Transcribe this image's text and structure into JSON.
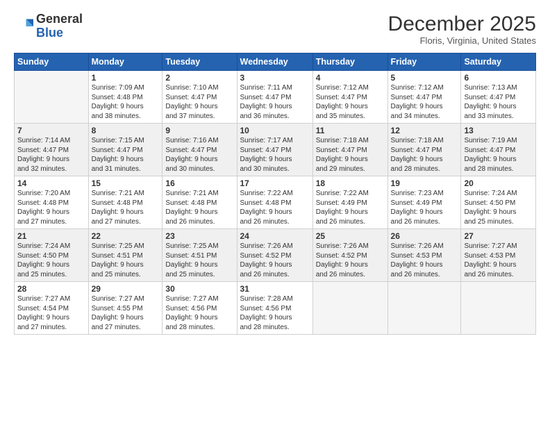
{
  "logo": {
    "general": "General",
    "blue": "Blue"
  },
  "header": {
    "month": "December 2025",
    "location": "Floris, Virginia, United States"
  },
  "weekdays": [
    "Sunday",
    "Monday",
    "Tuesday",
    "Wednesday",
    "Thursday",
    "Friday",
    "Saturday"
  ],
  "weeks": [
    [
      {
        "day": "",
        "info": ""
      },
      {
        "day": "1",
        "info": "Sunrise: 7:09 AM\nSunset: 4:48 PM\nDaylight: 9 hours\nand 38 minutes."
      },
      {
        "day": "2",
        "info": "Sunrise: 7:10 AM\nSunset: 4:47 PM\nDaylight: 9 hours\nand 37 minutes."
      },
      {
        "day": "3",
        "info": "Sunrise: 7:11 AM\nSunset: 4:47 PM\nDaylight: 9 hours\nand 36 minutes."
      },
      {
        "day": "4",
        "info": "Sunrise: 7:12 AM\nSunset: 4:47 PM\nDaylight: 9 hours\nand 35 minutes."
      },
      {
        "day": "5",
        "info": "Sunrise: 7:12 AM\nSunset: 4:47 PM\nDaylight: 9 hours\nand 34 minutes."
      },
      {
        "day": "6",
        "info": "Sunrise: 7:13 AM\nSunset: 4:47 PM\nDaylight: 9 hours\nand 33 minutes."
      }
    ],
    [
      {
        "day": "7",
        "info": "Sunrise: 7:14 AM\nSunset: 4:47 PM\nDaylight: 9 hours\nand 32 minutes."
      },
      {
        "day": "8",
        "info": "Sunrise: 7:15 AM\nSunset: 4:47 PM\nDaylight: 9 hours\nand 31 minutes."
      },
      {
        "day": "9",
        "info": "Sunrise: 7:16 AM\nSunset: 4:47 PM\nDaylight: 9 hours\nand 30 minutes."
      },
      {
        "day": "10",
        "info": "Sunrise: 7:17 AM\nSunset: 4:47 PM\nDaylight: 9 hours\nand 30 minutes."
      },
      {
        "day": "11",
        "info": "Sunrise: 7:18 AM\nSunset: 4:47 PM\nDaylight: 9 hours\nand 29 minutes."
      },
      {
        "day": "12",
        "info": "Sunrise: 7:18 AM\nSunset: 4:47 PM\nDaylight: 9 hours\nand 28 minutes."
      },
      {
        "day": "13",
        "info": "Sunrise: 7:19 AM\nSunset: 4:47 PM\nDaylight: 9 hours\nand 28 minutes."
      }
    ],
    [
      {
        "day": "14",
        "info": "Sunrise: 7:20 AM\nSunset: 4:48 PM\nDaylight: 9 hours\nand 27 minutes."
      },
      {
        "day": "15",
        "info": "Sunrise: 7:21 AM\nSunset: 4:48 PM\nDaylight: 9 hours\nand 27 minutes."
      },
      {
        "day": "16",
        "info": "Sunrise: 7:21 AM\nSunset: 4:48 PM\nDaylight: 9 hours\nand 26 minutes."
      },
      {
        "day": "17",
        "info": "Sunrise: 7:22 AM\nSunset: 4:48 PM\nDaylight: 9 hours\nand 26 minutes."
      },
      {
        "day": "18",
        "info": "Sunrise: 7:22 AM\nSunset: 4:49 PM\nDaylight: 9 hours\nand 26 minutes."
      },
      {
        "day": "19",
        "info": "Sunrise: 7:23 AM\nSunset: 4:49 PM\nDaylight: 9 hours\nand 26 minutes."
      },
      {
        "day": "20",
        "info": "Sunrise: 7:24 AM\nSunset: 4:50 PM\nDaylight: 9 hours\nand 25 minutes."
      }
    ],
    [
      {
        "day": "21",
        "info": "Sunrise: 7:24 AM\nSunset: 4:50 PM\nDaylight: 9 hours\nand 25 minutes."
      },
      {
        "day": "22",
        "info": "Sunrise: 7:25 AM\nSunset: 4:51 PM\nDaylight: 9 hours\nand 25 minutes."
      },
      {
        "day": "23",
        "info": "Sunrise: 7:25 AM\nSunset: 4:51 PM\nDaylight: 9 hours\nand 25 minutes."
      },
      {
        "day": "24",
        "info": "Sunrise: 7:26 AM\nSunset: 4:52 PM\nDaylight: 9 hours\nand 26 minutes."
      },
      {
        "day": "25",
        "info": "Sunrise: 7:26 AM\nSunset: 4:52 PM\nDaylight: 9 hours\nand 26 minutes."
      },
      {
        "day": "26",
        "info": "Sunrise: 7:26 AM\nSunset: 4:53 PM\nDaylight: 9 hours\nand 26 minutes."
      },
      {
        "day": "27",
        "info": "Sunrise: 7:27 AM\nSunset: 4:53 PM\nDaylight: 9 hours\nand 26 minutes."
      }
    ],
    [
      {
        "day": "28",
        "info": "Sunrise: 7:27 AM\nSunset: 4:54 PM\nDaylight: 9 hours\nand 27 minutes."
      },
      {
        "day": "29",
        "info": "Sunrise: 7:27 AM\nSunset: 4:55 PM\nDaylight: 9 hours\nand 27 minutes."
      },
      {
        "day": "30",
        "info": "Sunrise: 7:27 AM\nSunset: 4:56 PM\nDaylight: 9 hours\nand 28 minutes."
      },
      {
        "day": "31",
        "info": "Sunrise: 7:28 AM\nSunset: 4:56 PM\nDaylight: 9 hours\nand 28 minutes."
      },
      {
        "day": "",
        "info": ""
      },
      {
        "day": "",
        "info": ""
      },
      {
        "day": "",
        "info": ""
      }
    ]
  ]
}
